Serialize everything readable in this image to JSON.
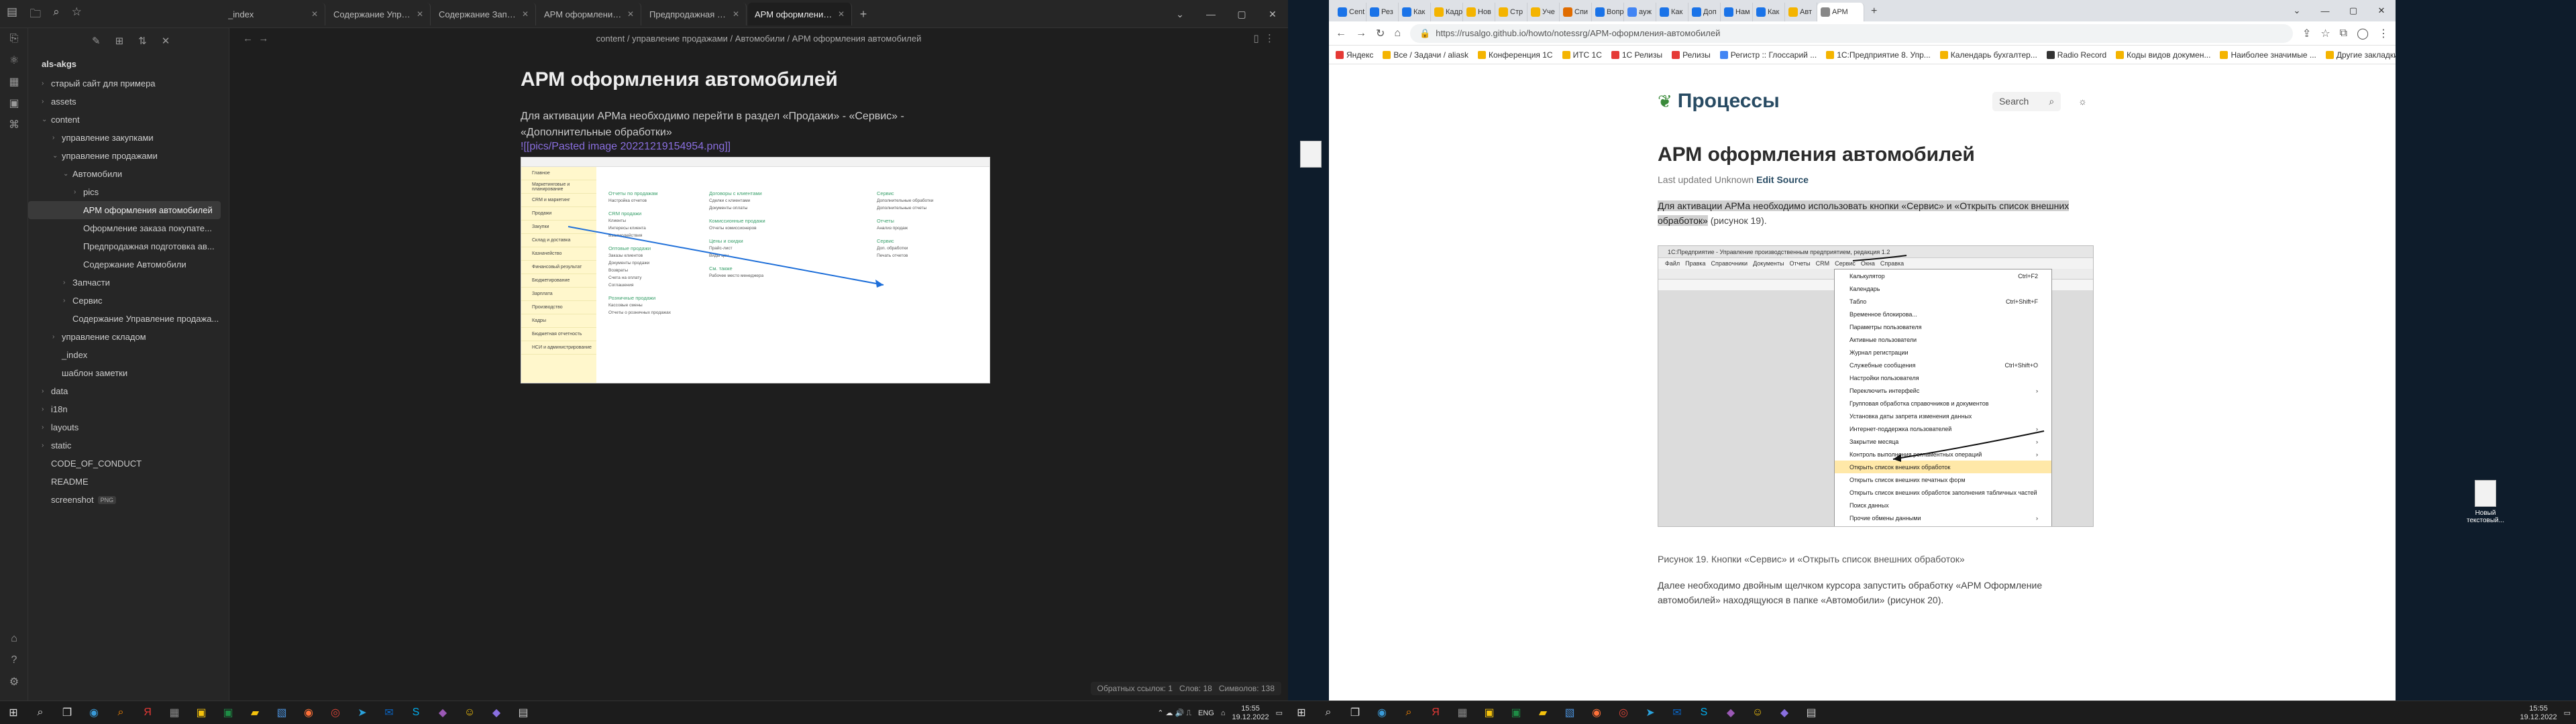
{
  "obsidian": {
    "tabs": [
      {
        "label": "_index"
      },
      {
        "label": "Содержание Управлени..."
      },
      {
        "label": "Содержание Запчасти"
      },
      {
        "label": "АРМ оформления автом..."
      },
      {
        "label": "Предпродажная подгото..."
      },
      {
        "label": "АРМ оформления автом..."
      }
    ],
    "vault_name": "als-akgs",
    "tree": [
      {
        "label": "старый сайт для примера",
        "depth": 0,
        "arrow": "›"
      },
      {
        "label": "assets",
        "depth": 0,
        "arrow": "›"
      },
      {
        "label": "content",
        "depth": 0,
        "arrow": "⌄"
      },
      {
        "label": "управление закупками",
        "depth": 1,
        "arrow": "›"
      },
      {
        "label": "управление продажами",
        "depth": 1,
        "arrow": "⌄"
      },
      {
        "label": "Автомобили",
        "depth": 2,
        "arrow": "⌄"
      },
      {
        "label": "pics",
        "depth": 3,
        "arrow": "›"
      },
      {
        "label": "АРМ оформления автомобилей",
        "depth": 3,
        "arrow": "",
        "active": true
      },
      {
        "label": "Оформление заказа покупате...",
        "depth": 3,
        "arrow": ""
      },
      {
        "label": "Предпродажная подготовка ав...",
        "depth": 3,
        "arrow": ""
      },
      {
        "label": "Содержание Автомобили",
        "depth": 3,
        "arrow": ""
      },
      {
        "label": "Запчасти",
        "depth": 2,
        "arrow": "›"
      },
      {
        "label": "Сервис",
        "depth": 2,
        "arrow": "›"
      },
      {
        "label": "Содержание Управление продажа...",
        "depth": 2,
        "arrow": ""
      },
      {
        "label": "управление складом",
        "depth": 1,
        "arrow": "›"
      },
      {
        "label": "_index",
        "depth": 1,
        "arrow": ""
      },
      {
        "label": "шаблон заметки",
        "depth": 1,
        "arrow": ""
      },
      {
        "label": "data",
        "depth": 0,
        "arrow": "›"
      },
      {
        "label": "i18n",
        "depth": 0,
        "arrow": "›"
      },
      {
        "label": "layouts",
        "depth": 0,
        "arrow": "›"
      },
      {
        "label": "static",
        "depth": 0,
        "arrow": "›"
      },
      {
        "label": "CODE_OF_CONDUCT",
        "depth": 0,
        "arrow": ""
      },
      {
        "label": "README",
        "depth": 0,
        "arrow": ""
      },
      {
        "label": "screenshot",
        "depth": 0,
        "arrow": "",
        "badge": "PNG"
      }
    ],
    "breadcrumb": "content / управление продажами / Автомобили / АРМ оформления автомобилей",
    "title": "АРМ оформления автомобилей",
    "paragraph": "Для активации АРМа необходимо перейти в раздел «Продажи» - «Сервис» - «Дополнительные обработки»",
    "link": "![[pics/Pasted image 20221219154954.png]]",
    "shot_sidebar": [
      "Главное",
      "Маркетинговые и планирование",
      "CRM и маркетинг",
      "Продажи",
      "Закупки",
      "Склад и доставка",
      "Казначейство",
      "Финансовый результат",
      "Бюджетирование",
      "Зарплата",
      "Производство",
      "Кадры",
      "Бюджетная отчетность",
      "НСИ и администрирование"
    ],
    "status": {
      "backlinks": "Обратных ссылок: 1",
      "words": "Слов: 18",
      "chars": "Символов: 138"
    }
  },
  "browser": {
    "tabs": [
      {
        "label": "Cent",
        "color": "#1a73e8"
      },
      {
        "label": "Рез",
        "color": "#1a73e8"
      },
      {
        "label": "Как",
        "color": "#1a73e8"
      },
      {
        "label": "Кадр",
        "color": "#f4b400"
      },
      {
        "label": "Нов",
        "color": "#f4b400"
      },
      {
        "label": "Стр",
        "color": "#f4b400"
      },
      {
        "label": "Уче",
        "color": "#f4b400"
      },
      {
        "label": "Спи",
        "color": "#e06c00"
      },
      {
        "label": "Вопр",
        "color": "#1a73e8"
      },
      {
        "label": "ауж",
        "color": "#4285f4"
      },
      {
        "label": "Как",
        "color": "#1a73e8"
      },
      {
        "label": "Доп",
        "color": "#1a73e8"
      },
      {
        "label": "Нам",
        "color": "#1a73e8"
      },
      {
        "label": "Как",
        "color": "#1a73e8"
      },
      {
        "label": "Авт",
        "color": "#f4b400"
      },
      {
        "label": "АРМ",
        "color": "#888888",
        "active": true
      }
    ],
    "url": "https://rusalgo.github.io/howto/notessrg/APM-оформления-автомобилей",
    "bookmarks": [
      "Яндекс",
      "Все / Задачи / aliask",
      "Конференция 1С",
      "ИТС 1С",
      "1С Релизы",
      "Релизы",
      "Регистр :: Глоссарий ...",
      "1С:Предприятие 8. Упр...",
      "Календарь бухгалтер...",
      "Radio Record",
      "Коды видов докумен...",
      "Наиболее значимые ...",
      "Другие закладки"
    ]
  },
  "site": {
    "title": "Процессы",
    "search_label": "Search",
    "h1": "АРМ оформления автомобилей",
    "updated": "Last updated Unknown",
    "edit_source": "Edit Source",
    "p1_highlight": "Для активации АРМа необходимо использовать кнопки «Сервис» и «Открыть список внешних обработок»",
    "p1_tail": "(рисунок 19).",
    "figure_title": "1С:Предприятие - Управление производственным предприятием, редакция 1.2",
    "figure_menubar": [
      "Файл",
      "Правка",
      "Справочники",
      "Документы",
      "Отчеты",
      "CRM",
      "Сервис",
      "Окна",
      "Справка"
    ],
    "figure_menu": [
      {
        "label": "Калькулятор",
        "key": "Ctrl+F2"
      },
      {
        "label": "Календарь",
        "key": ""
      },
      {
        "label": "Табло",
        "key": "Ctrl+Shift+F"
      },
      {
        "label": "Временное блокирова...",
        "key": ""
      },
      {
        "label": "Параметры пользователя",
        "key": ""
      },
      {
        "label": "Активные пользователи",
        "key": ""
      },
      {
        "label": "Журнал регистрации",
        "key": ""
      },
      {
        "label": "Служебные сообщения",
        "key": "Ctrl+Shift+O"
      },
      {
        "label": "Настройки пользователя",
        "key": ""
      },
      {
        "label": "Переключить интерфейс",
        "key": "›"
      },
      {
        "label": "Групповая обработка справочников и документов",
        "key": ""
      },
      {
        "label": "Установка даты запрета изменения данных",
        "key": ""
      },
      {
        "label": "Интернет-поддержка пользователей",
        "key": "›"
      },
      {
        "label": "Закрытие месяца",
        "key": "›"
      },
      {
        "label": "Контроль выполнения регламентных операций",
        "key": "›"
      },
      {
        "label": "Открыть список внешних обработок",
        "key": "",
        "sel": true
      },
      {
        "label": "Открыть список внешних печатных форм",
        "key": ""
      },
      {
        "label": "Открыть список внешних обработок заполнения табличных частей",
        "key": ""
      },
      {
        "label": "Поиск данных",
        "key": ""
      },
      {
        "label": "Прочие обмены данными",
        "key": "›"
      }
    ],
    "caption": "Рисунок 19. Кнопки «Сервис» и «Открыть список внешних обработок»",
    "p2": "Далее необходимо двойным щелчком курсора запустить обработку «АРМ Оформление автомобилей» находящуюся в папке «Автомобили» (рисунок 20)."
  },
  "desktop": {
    "icon_right_label": "Новый текстовый..."
  },
  "taskbar_left": {
    "lang": "ENG",
    "time": "15:55",
    "date": "19.12.2022"
  },
  "taskbar_right": {
    "time": "15:55",
    "date": "19.12.2022"
  }
}
